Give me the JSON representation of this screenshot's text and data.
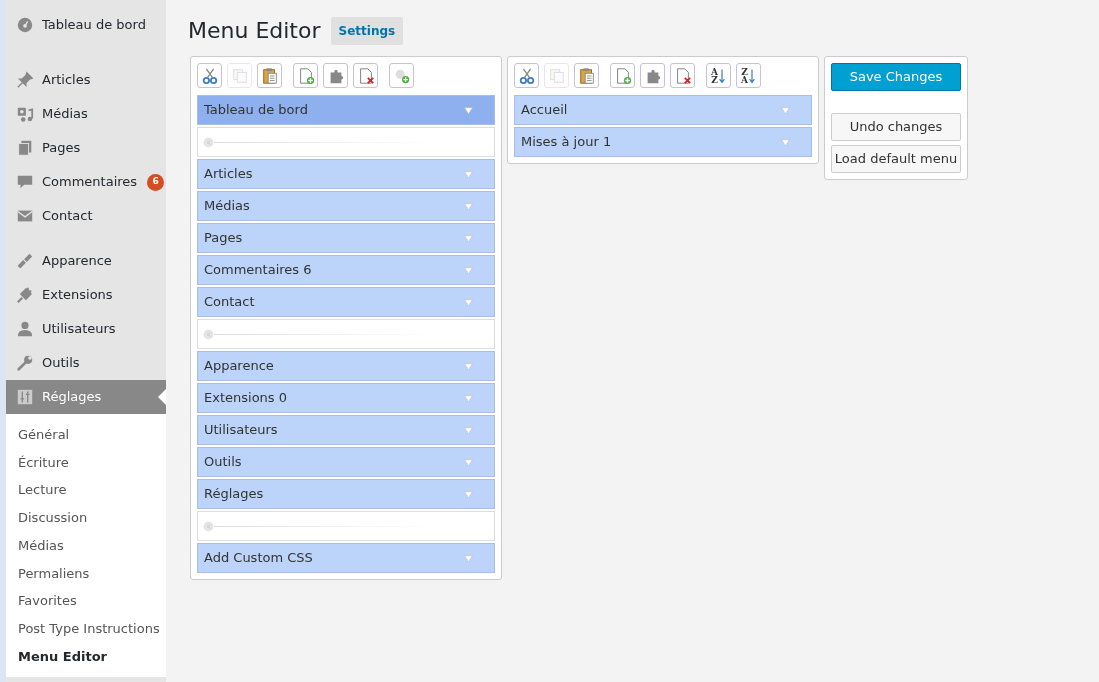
{
  "sidebar": {
    "groups": [
      [
        {
          "label": "Tableau de bord",
          "selected": false
        }
      ],
      [
        {
          "label": "Articles",
          "selected": false
        },
        {
          "label": "Médias",
          "selected": false
        },
        {
          "label": "Pages",
          "selected": false
        },
        {
          "label": "Commentaires",
          "selected": false,
          "badge": "6"
        },
        {
          "label": "Contact",
          "selected": false
        }
      ],
      [
        {
          "label": "Apparence",
          "selected": false
        },
        {
          "label": "Extensions",
          "selected": false
        },
        {
          "label": "Utilisateurs",
          "selected": false
        },
        {
          "label": "Outils",
          "selected": false
        },
        {
          "label": "Réglages",
          "selected": true
        }
      ]
    ],
    "submenu": [
      {
        "label": "Général",
        "selected": false
      },
      {
        "label": "Écriture",
        "selected": false
      },
      {
        "label": "Lecture",
        "selected": false
      },
      {
        "label": "Discussion",
        "selected": false
      },
      {
        "label": "Médias",
        "selected": false
      },
      {
        "label": "Permaliens",
        "selected": false
      },
      {
        "label": "Favorites",
        "selected": false
      },
      {
        "label": "Post Type Instructions",
        "selected": false
      },
      {
        "label": "Menu Editor",
        "selected": true
      }
    ]
  },
  "header": {
    "title": "Menu Editor",
    "settings_link": "Settings"
  },
  "main_menu": {
    "toolbar": [
      [
        {
          "kind": "cut",
          "disabled": false
        },
        {
          "kind": "copy",
          "disabled": true
        },
        {
          "kind": "paste",
          "disabled": false
        }
      ],
      [
        {
          "kind": "new",
          "disabled": false
        },
        {
          "kind": "puzzle",
          "disabled": false
        },
        {
          "kind": "delete",
          "disabled": false
        }
      ],
      [
        {
          "kind": "separator",
          "disabled": false
        }
      ]
    ],
    "items": [
      {
        "kind": "item",
        "label": "Tableau de bord",
        "selected": true
      },
      {
        "kind": "separator"
      },
      {
        "kind": "item",
        "label": "Articles",
        "selected": false
      },
      {
        "kind": "item",
        "label": "Médias",
        "selected": false
      },
      {
        "kind": "item",
        "label": "Pages",
        "selected": false
      },
      {
        "kind": "item",
        "label": "Commentaires 6",
        "selected": false
      },
      {
        "kind": "item",
        "label": "Contact",
        "selected": false
      },
      {
        "kind": "separator"
      },
      {
        "kind": "item",
        "label": "Apparence",
        "selected": false
      },
      {
        "kind": "item",
        "label": "Extensions 0",
        "selected": false
      },
      {
        "kind": "item",
        "label": "Utilisateurs",
        "selected": false
      },
      {
        "kind": "item",
        "label": "Outils",
        "selected": false
      },
      {
        "kind": "item",
        "label": "Réglages",
        "selected": false
      },
      {
        "kind": "separator"
      },
      {
        "kind": "item",
        "label": "Add Custom CSS",
        "selected": false
      }
    ]
  },
  "submenu_editor": {
    "toolbar": [
      [
        {
          "kind": "cut",
          "disabled": false
        },
        {
          "kind": "copy",
          "disabled": true
        },
        {
          "kind": "paste",
          "disabled": false
        }
      ],
      [
        {
          "kind": "new",
          "disabled": false
        },
        {
          "kind": "puzzle",
          "disabled": false
        },
        {
          "kind": "delete",
          "disabled": false
        }
      ],
      [
        {
          "kind": "sort",
          "top": "A",
          "bottom": "Z",
          "disabled": false
        },
        {
          "kind": "sort",
          "top": "Z",
          "bottom": "A",
          "disabled": false
        }
      ]
    ],
    "items": [
      {
        "kind": "item",
        "label": "Accueil",
        "selected": false
      },
      {
        "kind": "item",
        "label": "Mises à jour 1",
        "selected": false
      }
    ]
  },
  "actions": [
    {
      "kind": "primary",
      "label": "Save Changes"
    },
    {
      "kind": "secondary",
      "label": "Undo changes"
    },
    {
      "kind": "secondary",
      "label": "Load default menu"
    }
  ]
}
